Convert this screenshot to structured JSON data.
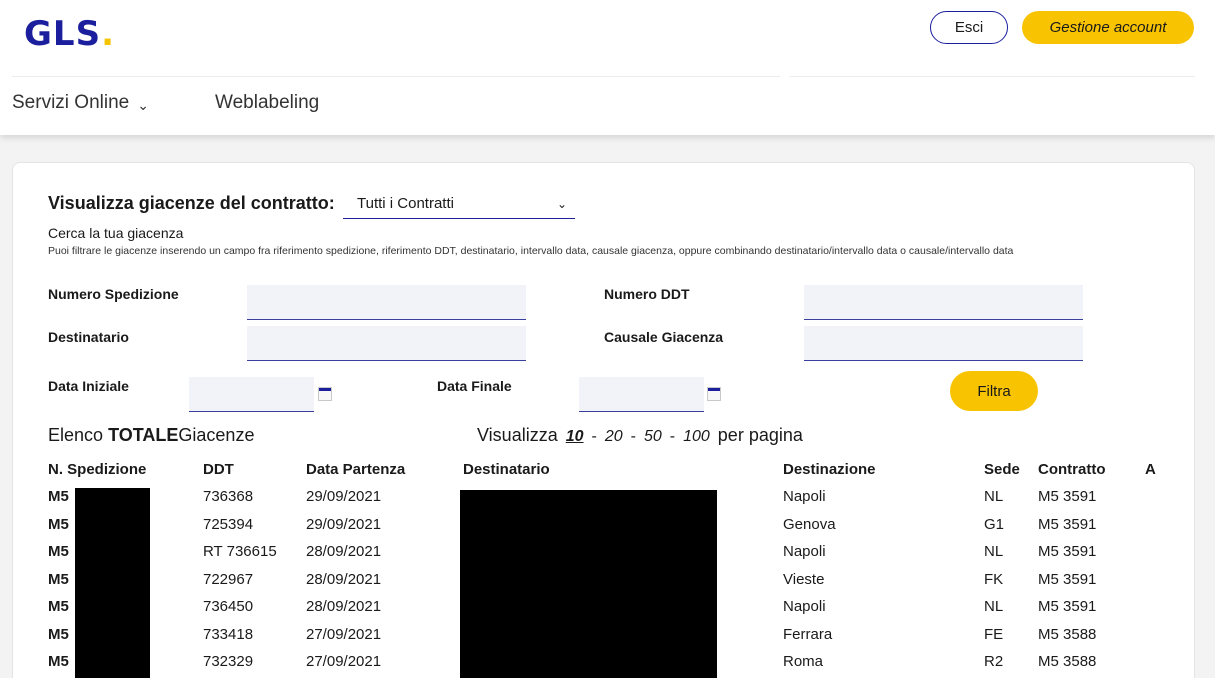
{
  "header": {
    "logo_text": "GLS",
    "logo_dot": ".",
    "logout_label": "Esci",
    "account_label": "Gestione account",
    "nav": [
      {
        "label": "Servizi Online",
        "has_dropdown": true
      },
      {
        "label": "Weblabeling"
      }
    ]
  },
  "filter": {
    "title": "Visualizza giacenze del contratto:",
    "contract_select": "Tutti i Contratti",
    "subtitle": "Cerca la tua giacenza",
    "hint": "Puoi filtrare le giacenze inserendo un campo fra riferimento spedizione, riferimento DDT, destinatario, intervallo data, causale giacenza, oppure combinando destinatario/intervallo data o causale/intervallo data",
    "labels": {
      "numero_spedizione": "Numero Spedizione",
      "numero_ddt": "Numero DDT",
      "destinatario": "Destinatario",
      "causale_giacenza": "Causale Giacenza",
      "data_iniziale": "Data Iniziale",
      "data_finale": "Data Finale"
    },
    "values": {
      "numero_spedizione": "",
      "numero_ddt": "",
      "destinatario": "",
      "causale_giacenza": "",
      "data_iniziale": "",
      "data_finale": ""
    },
    "filter_button": "Filtra"
  },
  "list": {
    "title_prefix": "Elenco",
    "title_bold": "TOTALE",
    "title_suffix": "Giacenze",
    "per_page_prefix": "Visualizza",
    "per_page_options": [
      "10",
      "20",
      "50",
      "100"
    ],
    "per_page_selected": "10",
    "per_page_suffix": "per pagina",
    "columns": [
      "N. Spedizione",
      "DDT",
      "Data Partenza",
      "Destinatario",
      "Destinazione",
      "Sede",
      "Contratto",
      "A"
    ],
    "rows": [
      {
        "spedizione": "M5",
        "ddt": "736368",
        "data": "29/09/2021",
        "destinazione": "Napoli",
        "sede": "NL",
        "contratto": "M5 3591"
      },
      {
        "spedizione": "M5",
        "ddt": "725394",
        "data": "29/09/2021",
        "destinazione": "Genova",
        "sede": "G1",
        "contratto": "M5 3591"
      },
      {
        "spedizione": "M5",
        "ddt": "RT 736615",
        "data": "28/09/2021",
        "destinazione": "Napoli",
        "sede": "NL",
        "contratto": "M5 3591"
      },
      {
        "spedizione": "M5",
        "ddt": "722967",
        "data": "28/09/2021",
        "destinazione": "Vieste",
        "sede": "FK",
        "contratto": "M5 3591"
      },
      {
        "spedizione": "M5",
        "ddt": "736450",
        "data": "28/09/2021",
        "destinazione": "Napoli",
        "sede": "NL",
        "contratto": "M5 3591"
      },
      {
        "spedizione": "M5",
        "ddt": "733418",
        "data": "27/09/2021",
        "destinazione": "Ferrara",
        "sede": "FE",
        "contratto": "M5 3588"
      },
      {
        "spedizione": "M5",
        "ddt": "732329",
        "data": "27/09/2021",
        "destinazione": "Roma",
        "sede": "R2",
        "contratto": "M5 3588"
      }
    ]
  },
  "colors": {
    "brand_blue": "#1b1f9e",
    "brand_yellow": "#f8c300"
  }
}
